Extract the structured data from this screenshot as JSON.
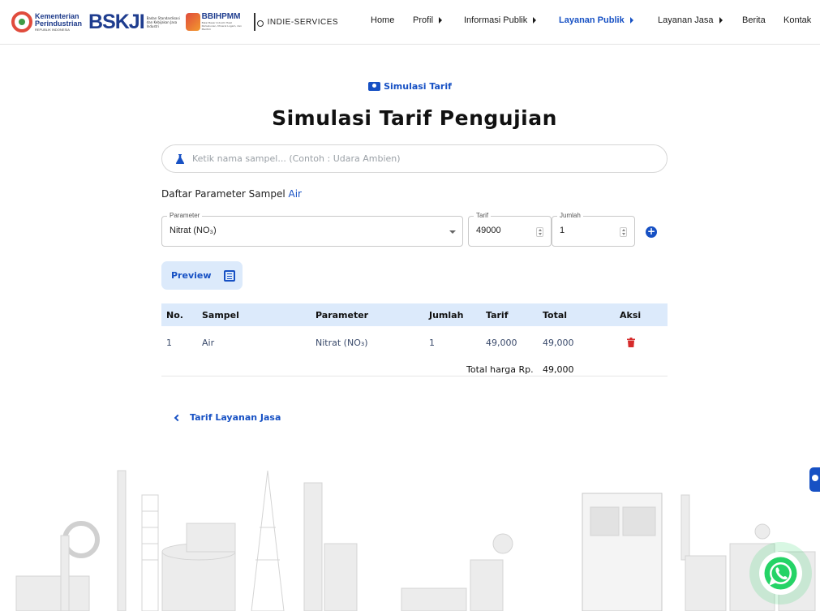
{
  "header": {
    "logos": {
      "kemenperin_line1": "Kementerian",
      "kemenperin_line2": "Perindustrian",
      "kemenperin_line3": "REPUBLIK INDONESIA",
      "bskji": "BSKJI",
      "bskji_sub": "Badan Standardisasi dan Kebijakan Jasa Industri",
      "bbihpmm": "BBIHPMM",
      "bbihpmm_sub": "Balai Besar Industri Hasil Perkebunan, Mineral Logam, dan Maritim",
      "indie": "INDIE-SERVICES"
    },
    "nav": [
      {
        "label": "Home"
      },
      {
        "label": "Profil"
      },
      {
        "label": "Informasi Publik"
      },
      {
        "label": "Layanan Publik"
      },
      {
        "label": "Layanan Jasa"
      },
      {
        "label": "Berita"
      },
      {
        "label": "Kontak"
      }
    ],
    "active_nav": "Layanan Publik"
  },
  "main": {
    "eyebrow": "Simulasi Tarif",
    "title": "Simulasi Tarif Pengujian",
    "search_placeholder": "Ketik nama sampel... (Contoh : Udara Ambien)",
    "list_label": "Daftar Parameter Sampel",
    "list_sample": "Air",
    "form": {
      "parameter_label": "Parameter",
      "parameter_value": "Nitrat (NO₃)",
      "tarif_label": "Tarif",
      "tarif_value": "49000",
      "jumlah_label": "Jumlah",
      "jumlah_value": "1"
    },
    "preview_label": "Preview",
    "table": {
      "headers": [
        "No.",
        "Sampel",
        "Parameter",
        "Jumlah",
        "Tarif",
        "Total",
        "Aksi"
      ],
      "rows": [
        {
          "no": "1",
          "sampel": "Air",
          "parameter": "Nitrat (NO₃)",
          "jumlah": "1",
          "tarif": "49,000",
          "total": "49,000"
        }
      ],
      "total_label": "Total harga Rp.",
      "total_value": "49,000"
    },
    "back_label": "Tarif Layanan Jasa"
  },
  "colors": {
    "accent": "#1751c4",
    "header_bg": "#dceafb",
    "danger": "#d62b2b",
    "whatsapp": "#25d366"
  }
}
